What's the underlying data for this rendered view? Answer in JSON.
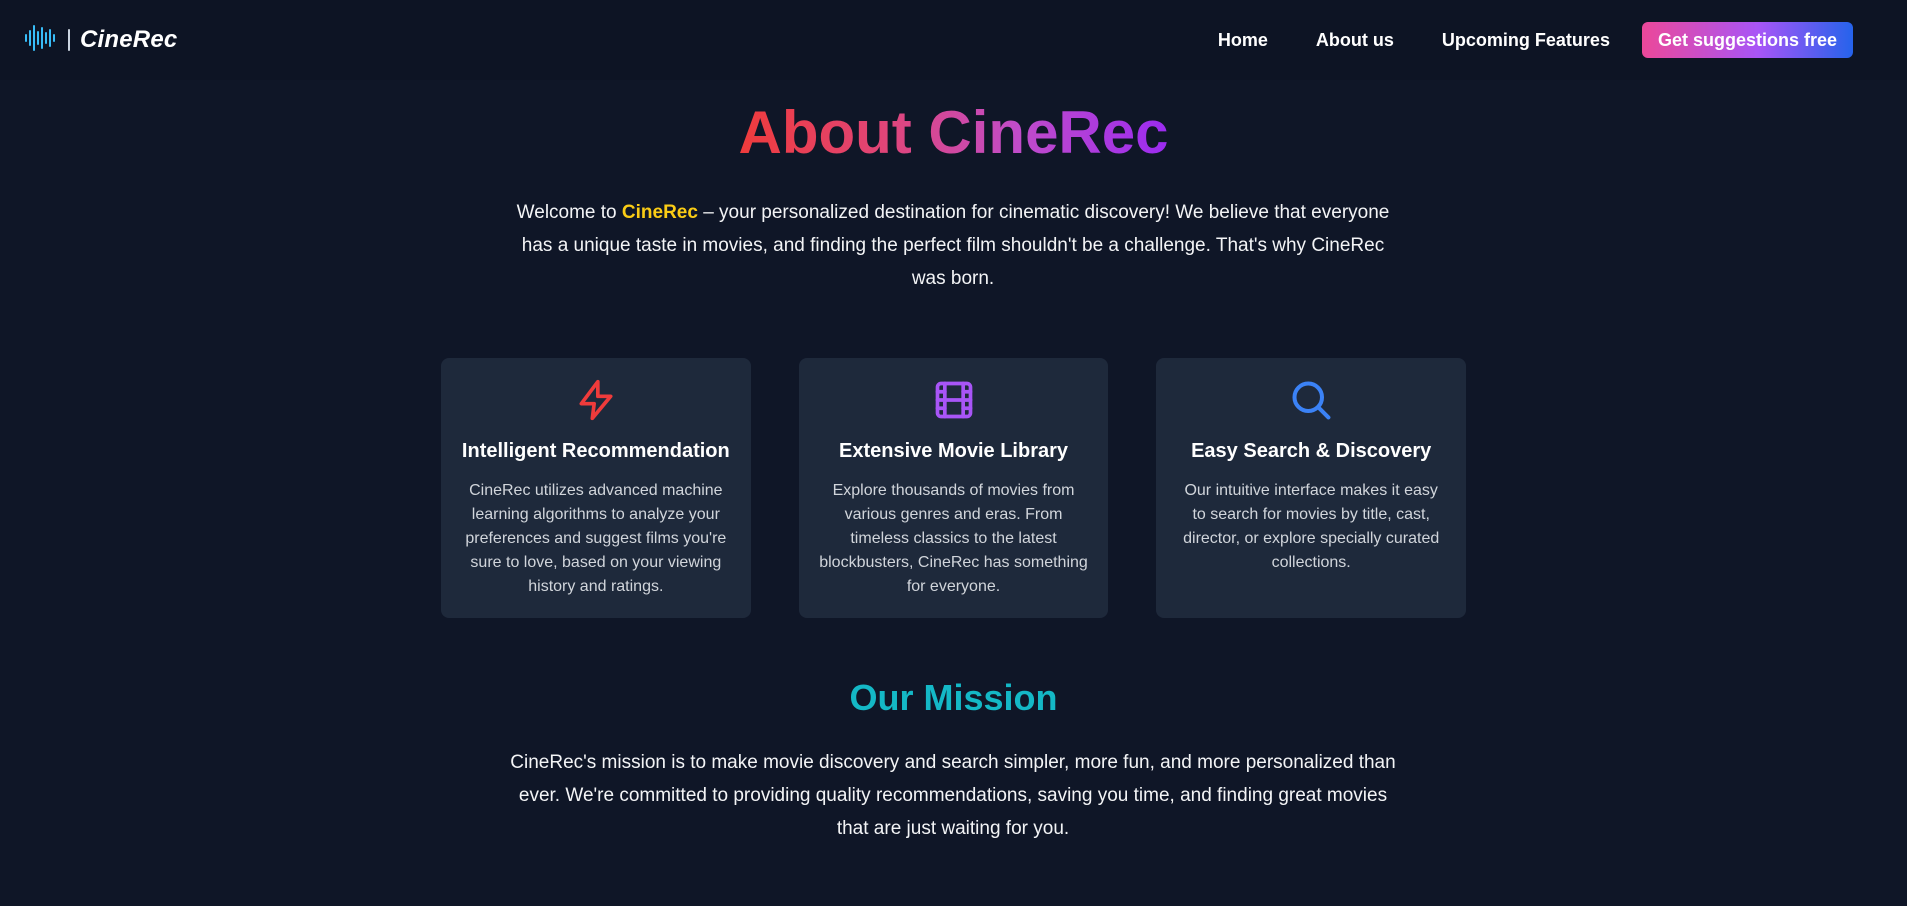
{
  "header": {
    "brand_name": "CineRec",
    "nav": {
      "home": "Home",
      "about": "About us",
      "upcoming": "Upcoming Features"
    },
    "cta_label": "Get suggestions free"
  },
  "hero": {
    "title": "About CineRec",
    "intro_prefix": "Welcome to ",
    "intro_brand": "CineRec",
    "intro_rest": " – your personalized destination for cinematic discovery! We believe that everyone has a unique taste in movies, and finding the perfect film shouldn't be a challenge. That's why CineRec was born."
  },
  "features": [
    {
      "icon": "lightning-icon",
      "title": "Intelligent Recommendation",
      "description": "CineRec utilizes advanced machine learning algorithms to analyze your preferences and suggest films you're sure to love, based on your viewing history and ratings."
    },
    {
      "icon": "film-icon",
      "title": "Extensive Movie Library",
      "description": "Explore thousands of movies from various genres and eras. From timeless classics to the latest blockbusters, CineRec has something for everyone."
    },
    {
      "icon": "search-icon",
      "title": "Easy Search & Discovery",
      "description": "Our intuitive interface makes it easy to search for movies by title, cast, director, or explore specially curated collections."
    }
  ],
  "mission": {
    "title": "Our Mission",
    "text": "CineRec's mission is to make movie discovery and search simpler, more fun, and more personalized than ever. We're committed to providing quality recommendations, saving you time, and finding great movies that are just waiting for you."
  },
  "colors": {
    "background": "#0f1627",
    "card": "#1e293b",
    "accent_yellow": "#facc15",
    "mission_teal": "#14b8c6",
    "icon_red": "#ef3b3b",
    "icon_purple": "#a855f7",
    "icon_blue": "#3b82f6"
  }
}
